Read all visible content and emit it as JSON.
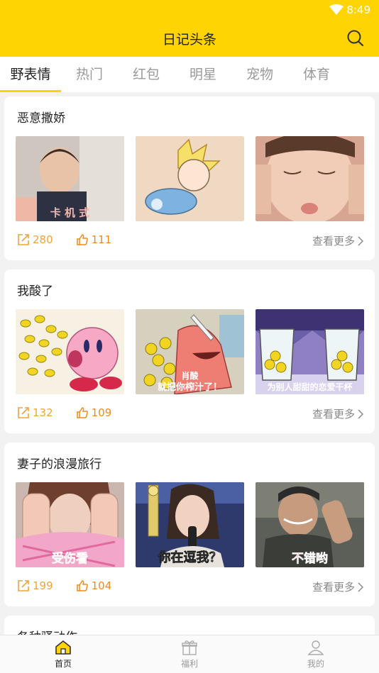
{
  "status": {
    "time": "8:49"
  },
  "header": {
    "title": "日记头条"
  },
  "tabs": [
    {
      "label": "野表情",
      "active": true
    },
    {
      "label": "热门"
    },
    {
      "label": "红包"
    },
    {
      "label": "明星"
    },
    {
      "label": "宠物"
    },
    {
      "label": "体育"
    }
  ],
  "cards": [
    {
      "title": "恶意撒娇",
      "shares": "280",
      "likes": "111",
      "more": "查看更多",
      "thumbs": [
        {
          "caption": "卡 机 式",
          "icon": "toddler-image"
        },
        {
          "caption": "",
          "icon": "cartoon-image"
        },
        {
          "caption": "",
          "icon": "child-face-image"
        }
      ]
    },
    {
      "title": "我酸了",
      "shares": "132",
      "likes": "109",
      "more": "查看更多",
      "thumbs": [
        {
          "caption": "",
          "icon": "kirby-lemons-image"
        },
        {
          "caption": "就把你榨汁了！",
          "icon": "patrick-lemons-image"
        },
        {
          "caption": "为别人甜甜的恋爱干杯",
          "icon": "lemon-cups-image"
        }
      ]
    },
    {
      "title": "妻子的浪漫旅行",
      "shares": "199",
      "likes": "104",
      "more": "查看更多",
      "thumbs": [
        {
          "caption": "受伤看",
          "icon": "woman-hands-image"
        },
        {
          "caption": "你在逗我？",
          "icon": "woman-mic-image"
        },
        {
          "caption": "不错哟",
          "icon": "man-clapping-image"
        }
      ]
    },
    {
      "title": "各种骚动作",
      "partial": true
    }
  ],
  "thumb_overlay": {
    "sour_caption": "肖酸"
  },
  "bottom_nav": [
    {
      "label": "首页",
      "icon": "home-icon",
      "active": true
    },
    {
      "label": "福利",
      "icon": "gift-icon"
    },
    {
      "label": "我的",
      "icon": "user-icon"
    }
  ],
  "colors": {
    "accent": "#FFD400",
    "count": "#EF8A1A"
  }
}
